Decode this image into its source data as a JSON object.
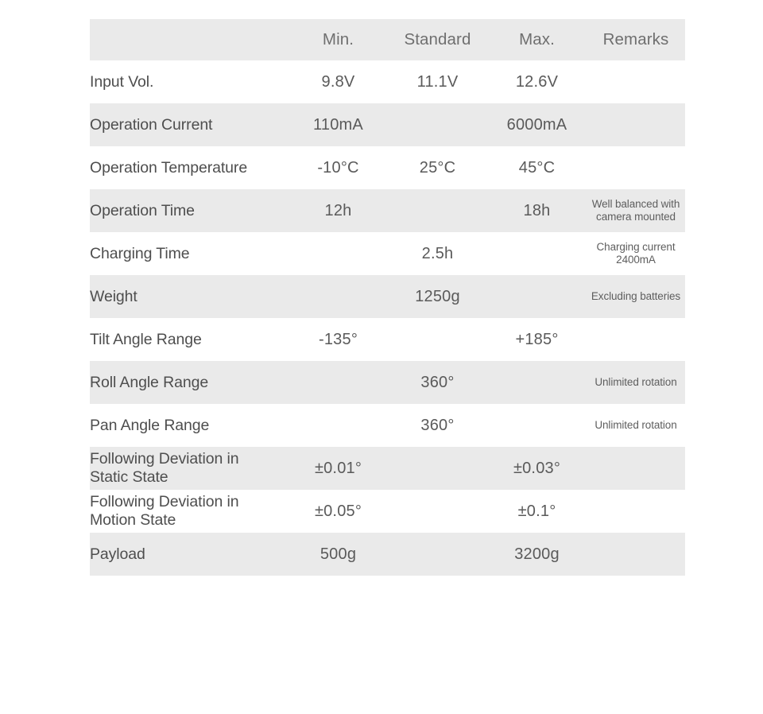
{
  "table": {
    "columns": [
      {
        "key": "name",
        "label": ""
      },
      {
        "key": "min",
        "label": "Min."
      },
      {
        "key": "standard",
        "label": "Standard"
      },
      {
        "key": "max",
        "label": "Max."
      },
      {
        "key": "remarks",
        "label": "Remarks"
      }
    ],
    "rows": [
      {
        "name": "Input Vol.",
        "min": "9.8V",
        "standard": "11.1V",
        "max": "12.6V",
        "remarks": ""
      },
      {
        "name": "Operation Current",
        "min": "110mA",
        "standard": "",
        "max": "6000mA",
        "remarks": ""
      },
      {
        "name": "Operation Temperature",
        "min": "-10°C",
        "standard": "25°C",
        "max": "45°C",
        "remarks": ""
      },
      {
        "name": "Operation Time",
        "min": "12h",
        "standard": "",
        "max": "18h",
        "remarks_line1": "Well balanced with",
        "remarks_line2": "camera mounted"
      },
      {
        "name": "Charging Time",
        "min": "",
        "standard": "2.5h",
        "max": "",
        "remarks_line1": "Charging current",
        "remarks_line2": "2400mA"
      },
      {
        "name": "Weight",
        "min": "",
        "standard": "1250g",
        "max": "",
        "remarks_line1": "Excluding batteries",
        "remarks_line2": ""
      },
      {
        "name": "Tilt Angle Range",
        "min": "-135°",
        "standard": "",
        "max": "+185°",
        "remarks": ""
      },
      {
        "name": "Roll Angle Range",
        "min": "",
        "standard": "360°",
        "max": "",
        "remarks_line1": "Unlimited rotation",
        "remarks_line2": ""
      },
      {
        "name": "Pan Angle Range",
        "min": "",
        "standard": "360°",
        "max": "",
        "remarks_line1": "Unlimited rotation",
        "remarks_line2": ""
      },
      {
        "name_line1": "Following Deviation in",
        "name_line2": "Static State",
        "min": "±0.01°",
        "standard": "",
        "max": "±0.03°",
        "remarks": ""
      },
      {
        "name_line1": "Following Deviation in",
        "name_line2": "Motion State",
        "min": "±0.05°",
        "standard": "",
        "max": "±0.1°",
        "remarks": ""
      },
      {
        "name": "Payload",
        "min": "500g",
        "standard": "",
        "max": "3200g",
        "remarks": ""
      }
    ]
  },
  "colors": {
    "row_alt_background": "#eaeaea",
    "row_background": "#ffffff",
    "text": "#4e4e4e",
    "header_text": "#6f6f6f",
    "page_background": "#ffffff"
  }
}
